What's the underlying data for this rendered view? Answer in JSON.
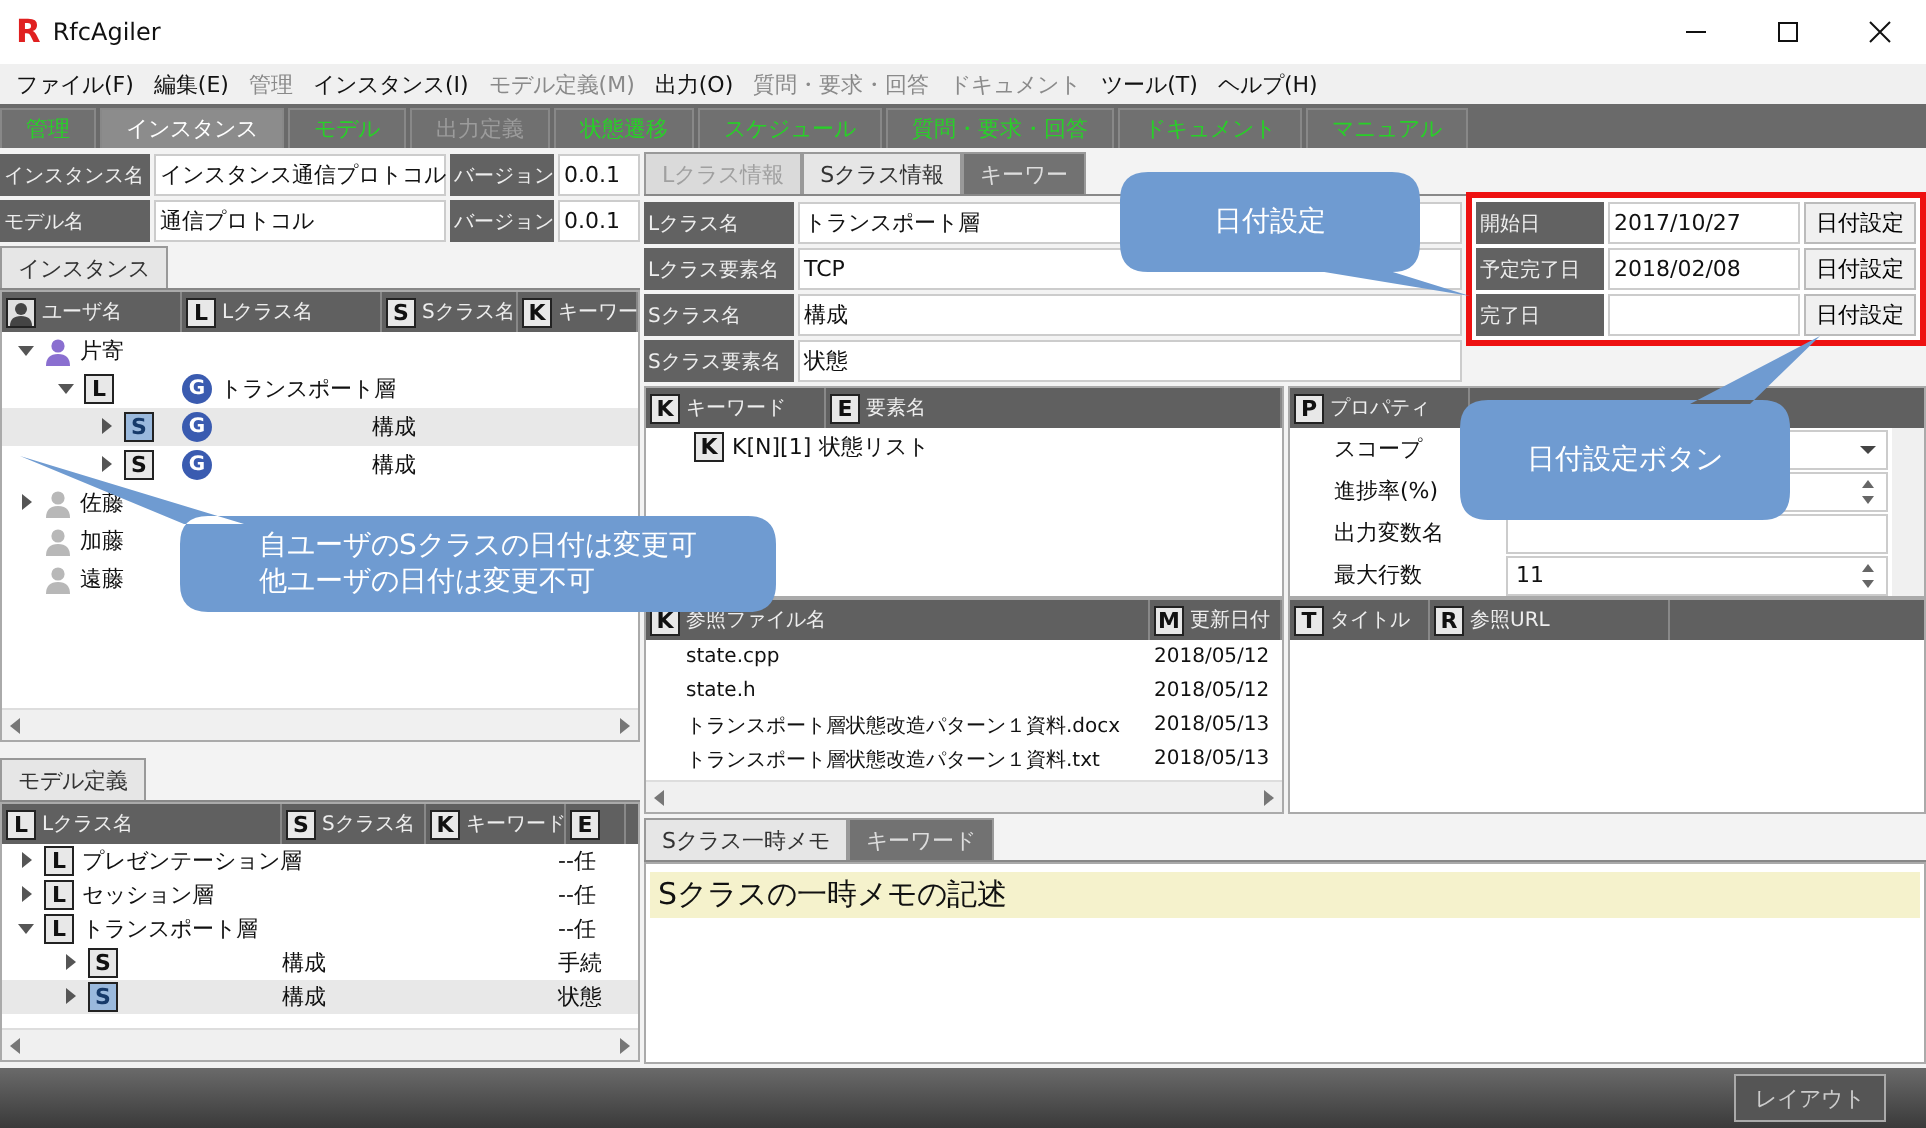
{
  "window": {
    "title": "RfcAgiler",
    "logo": "R"
  },
  "menu": [
    {
      "label": "ファイル(F)",
      "disabled": false
    },
    {
      "label": "編集(E)",
      "disabled": false
    },
    {
      "label": "管理",
      "disabled": true
    },
    {
      "label": "インスタンス(I)",
      "disabled": false
    },
    {
      "label": "モデル定義(M)",
      "disabled": true
    },
    {
      "label": "出力(O)",
      "disabled": false
    },
    {
      "label": "質問・要求・回答",
      "disabled": true
    },
    {
      "label": "ドキュメント",
      "disabled": true
    },
    {
      "label": "ツール(T)",
      "disabled": false
    },
    {
      "label": "ヘルプ(H)",
      "disabled": false
    }
  ],
  "main_tabs": [
    {
      "label": "管理",
      "selected": false,
      "disabled": false
    },
    {
      "label": "インスタンス",
      "selected": true,
      "disabled": false
    },
    {
      "label": "モデル",
      "selected": false,
      "disabled": false
    },
    {
      "label": "出力定義",
      "selected": false,
      "disabled": true
    },
    {
      "label": "状態遷移",
      "selected": false,
      "disabled": false
    },
    {
      "label": "スケジュール",
      "selected": false,
      "disabled": false
    },
    {
      "label": "質問・要求・回答",
      "selected": false,
      "disabled": false
    },
    {
      "label": "ドキュメント",
      "selected": false,
      "disabled": false
    },
    {
      "label": "マニュアル",
      "selected": false,
      "disabled": false
    }
  ],
  "instance_info": [
    {
      "label": "インスタンス名",
      "value": "インスタンス通信プロトコル",
      "version_label": "バージョン",
      "version": "0.0.1"
    },
    {
      "label": "モデル名",
      "value": "通信プロトコル",
      "version_label": "バージョン",
      "version": "0.0.1"
    }
  ],
  "instance_panel": {
    "tab": "インスタンス",
    "columns": [
      {
        "label": "ユーザ名",
        "kind": "user"
      },
      {
        "badge": "L",
        "label": "Lクラス名",
        "kind": "letter"
      },
      {
        "badge": "S",
        "label": "Sクラス名",
        "kind": "letter"
      },
      {
        "badge": "K",
        "label": "キーワー",
        "kind": "letter"
      }
    ],
    "tree": [
      {
        "kind": "user",
        "name": "片寄",
        "active": true,
        "expanded": true,
        "children": [
          {
            "kind": "lclass",
            "badge": "L",
            "g": "G",
            "name": "トランスポート層",
            "expanded": true,
            "children": [
              {
                "kind": "sclass",
                "badge": "S",
                "g": "G",
                "name": "構成",
                "expanded": false,
                "selected": true
              },
              {
                "kind": "sclass",
                "badge": "S",
                "g": "G",
                "name": "構成",
                "expanded": false,
                "selected": false
              }
            ]
          }
        ]
      },
      {
        "kind": "user",
        "name": "佐藤",
        "active": false,
        "expanded": false
      },
      {
        "kind": "user",
        "name": "加藤",
        "active": false
      },
      {
        "kind": "user",
        "name": "遠藤",
        "active": false
      }
    ]
  },
  "model_panel": {
    "tab": "モデル定義",
    "columns": [
      {
        "badge": "L",
        "label": "Lクラス名"
      },
      {
        "badge": "S",
        "label": "Sクラス名"
      },
      {
        "badge": "K",
        "label": "キーワード"
      },
      {
        "badge": "E"
      }
    ],
    "tree": [
      {
        "kind": "lclass",
        "badge": "L",
        "name": "プレゼンテーション層",
        "element": "--任",
        "expanded": false,
        "selected": false
      },
      {
        "kind": "lclass",
        "badge": "L",
        "name": "セッション層",
        "element": "--任",
        "expanded": false,
        "selected": false
      },
      {
        "kind": "lclass",
        "badge": "L",
        "name": "トランスポート層",
        "element": "--任",
        "expanded": true,
        "selected": false,
        "children": [
          {
            "kind": "sclass",
            "badge": "S",
            "name": "構成",
            "element": "手続",
            "expanded": false,
            "selected": false
          },
          {
            "kind": "sclass",
            "badge": "S",
            "name": "構成",
            "element": "状態",
            "expanded": false,
            "selected": true
          }
        ]
      }
    ]
  },
  "detail_tabs": [
    {
      "label": "Lクラス情報",
      "selected": false,
      "disabled": true
    },
    {
      "label": "Sクラス情報",
      "selected": true,
      "disabled": false
    },
    {
      "label": "キーワー",
      "selected": false,
      "disabled": false
    }
  ],
  "class_info": [
    {
      "label": "Lクラス名",
      "value": "トランスポート層"
    },
    {
      "label": "Lクラス要素名",
      "value": "TCP"
    },
    {
      "label": "Sクラス名",
      "value": "構成"
    },
    {
      "label": "Sクラス要素名",
      "value": "状態"
    }
  ],
  "dates": [
    {
      "label": "開始日",
      "value": "2017/10/27",
      "button": "日付設定"
    },
    {
      "label": "予定完了日",
      "value": "2018/02/08",
      "button": "日付設定"
    },
    {
      "label": "完了日",
      "button": "日付設定"
    }
  ],
  "keyword_panel": {
    "columns": [
      {
        "badge": "K",
        "label": "キーワード"
      },
      {
        "badge": "E",
        "label": "要素名"
      }
    ],
    "rows": [
      {
        "badge": "K",
        "keyword": "K[N][1]",
        "element": "状態リスト"
      }
    ]
  },
  "property_panel": {
    "columns": [
      {
        "badge": "P",
        "label": "プロパティ"
      }
    ],
    "rows": [
      {
        "kind": "combo",
        "label": "スコープ"
      },
      {
        "kind": "spin",
        "label": "進捗率(%)"
      },
      {
        "kind": "text",
        "label": "出力変数名"
      },
      {
        "kind": "spin",
        "label": "最大行数",
        "value": "11"
      }
    ]
  },
  "reference_panel": {
    "columns": [
      {
        "badge": "K",
        "label": "参照ファイル名"
      },
      {
        "badge": "M",
        "label": "更新日付"
      }
    ],
    "rows": [
      {
        "file": "state.cpp",
        "date": "2018/05/12"
      },
      {
        "file": "state.h",
        "date": "2018/05/12"
      },
      {
        "file": "トランスポート層状態改造パターン１資料.docx",
        "date": "2018/05/13"
      },
      {
        "file": "トランスポート層状態改造パターン１資料.txt",
        "date": "2018/05/13"
      }
    ]
  },
  "link_panel": {
    "columns": [
      {
        "badge": "T",
        "label": "タイトル"
      },
      {
        "badge": "R",
        "label": "参照URL"
      }
    ]
  },
  "memo_tabs": [
    {
      "label": "Sクラス一時メモ",
      "selected": true
    },
    {
      "label": "キーワード",
      "selected": false
    }
  ],
  "memo": {
    "lines": [
      "Sクラスの一時メモの記述"
    ]
  },
  "status_bar": {
    "button": "レイアウト"
  },
  "callouts": [
    {
      "lines": [
        "日付設定"
      ]
    },
    {
      "lines": [
        "日付設定ボタン"
      ]
    },
    {
      "lines": [
        "自ユーザのSクラスの日付は変更可",
        "他ユーザの日付は変更不可"
      ]
    }
  ]
}
